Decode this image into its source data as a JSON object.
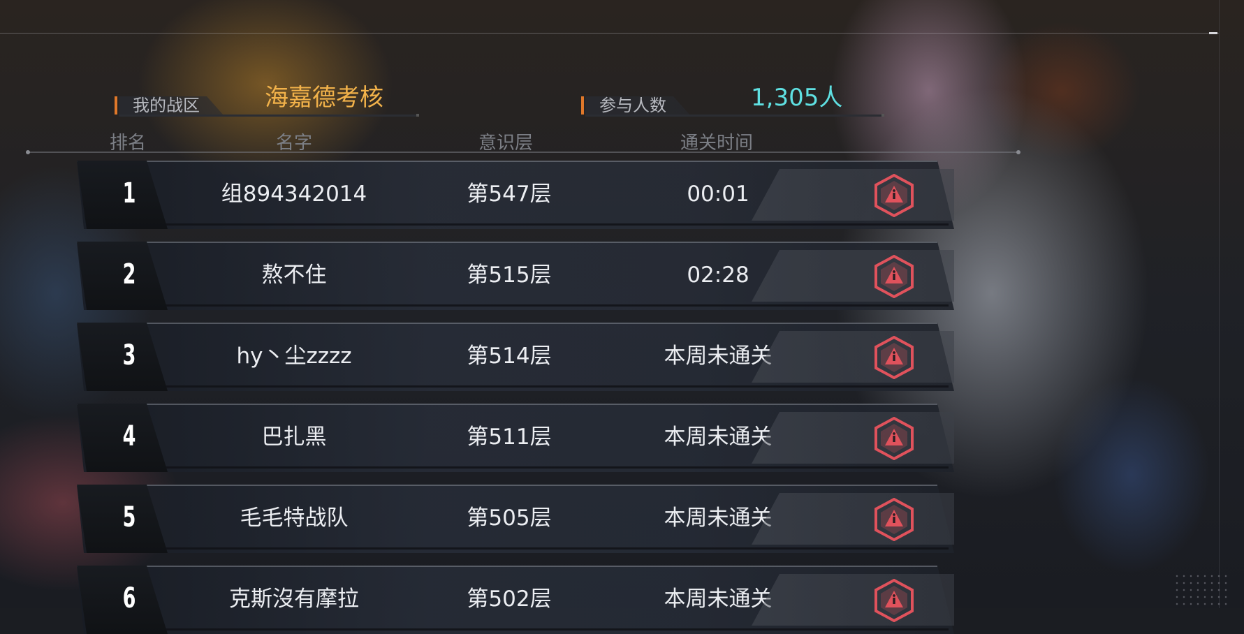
{
  "zone": {
    "label": "我的战区",
    "value": "海嘉德考核"
  },
  "participants": {
    "label": "参与人数",
    "value": "1,305人"
  },
  "headers": {
    "rank": "排名",
    "name": "名字",
    "layer": "意识层",
    "time": "通关时间"
  },
  "rows": [
    {
      "rank": "1",
      "name": "组894342014",
      "layer": "第547层",
      "time": "00:01",
      "icon": "report-icon"
    },
    {
      "rank": "2",
      "name": "熬不住",
      "layer": "第515层",
      "time": "02:28",
      "icon": "report-icon"
    },
    {
      "rank": "3",
      "name": "hy丶尘zzzz",
      "layer": "第514层",
      "time": "本周未通关",
      "icon": "report-icon"
    },
    {
      "rank": "4",
      "name": "巴扎黑",
      "layer": "第511层",
      "time": "本周未通关",
      "icon": "report-icon"
    },
    {
      "rank": "5",
      "name": "毛毛特战队",
      "layer": "第505层",
      "time": "本周未通关",
      "icon": "report-icon"
    },
    {
      "rank": "6",
      "name": "克斯沒有摩拉",
      "layer": "第502层",
      "time": "本周未通关",
      "icon": "report-icon"
    }
  ],
  "colors": {
    "accent": "#e0782a",
    "zone_value": "#f2b24a",
    "participants_value": "#5fe0e2",
    "badge": "#e0525c"
  }
}
